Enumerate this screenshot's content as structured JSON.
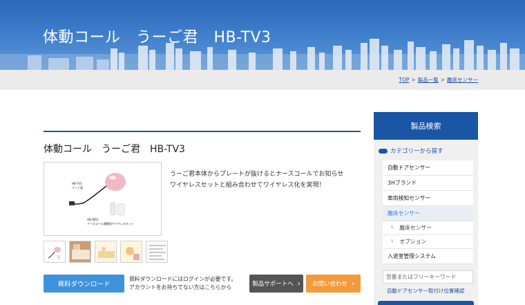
{
  "hero": {
    "title": "体動コール　うーご君　HB-TV3"
  },
  "breadcrumb": [
    {
      "label": "TOP"
    },
    {
      "label": "製品一覧"
    },
    {
      "label": "離床センサー"
    }
  ],
  "product": {
    "title": "体動コール　うーご君　HB-TV3",
    "description_lines": [
      "うーご君本体からプレートが抜けるとナースコールでお知らせ",
      "ワイヤレスセットと組み合わせてワイヤレス化を実現！"
    ],
    "image_labels": {
      "tv3": "HB-TV3",
      "tv3_name": "うーご君",
      "rjr3": "HB-RJR3",
      "rjr3_name": "ナースコール連動型ワイヤレスセット"
    },
    "thumbnail_count": 5
  },
  "actions": {
    "download": "資料ダウンロード",
    "login_note_line1": "資料ダウンロードにはログインが必要です。",
    "login_note_line2_prefix": "アカウントをお持ちでない方は",
    "login_note_link": "こちら",
    "login_note_line2_suffix": "から",
    "support": "製品サポートへ",
    "contact": "お問い合わせ",
    "chevron": "›"
  },
  "sidebar": {
    "header": "製品検索",
    "category_heading": "カテゴリーから探す",
    "items": [
      {
        "label": "自動ドアセンサー",
        "state": "normal"
      },
      {
        "label": "3Hブランド",
        "state": "normal"
      },
      {
        "label": "車両検知センサー",
        "state": "normal"
      },
      {
        "label": "離床センサー",
        "state": "active"
      },
      {
        "label": "離床センサー",
        "state": "sub"
      },
      {
        "label": "オプション",
        "state": "sub"
      },
      {
        "label": "入退室管理システム",
        "state": "normal"
      }
    ],
    "search_placeholder": "型番またはフリーキーワード",
    "link": "自動ドアセンサー取付け位置確認"
  },
  "colors": {
    "brand_blue": "#1b55a6",
    "download_blue": "#3f92dc",
    "support_gray": "#555555",
    "contact_orange": "#f39b3c"
  }
}
